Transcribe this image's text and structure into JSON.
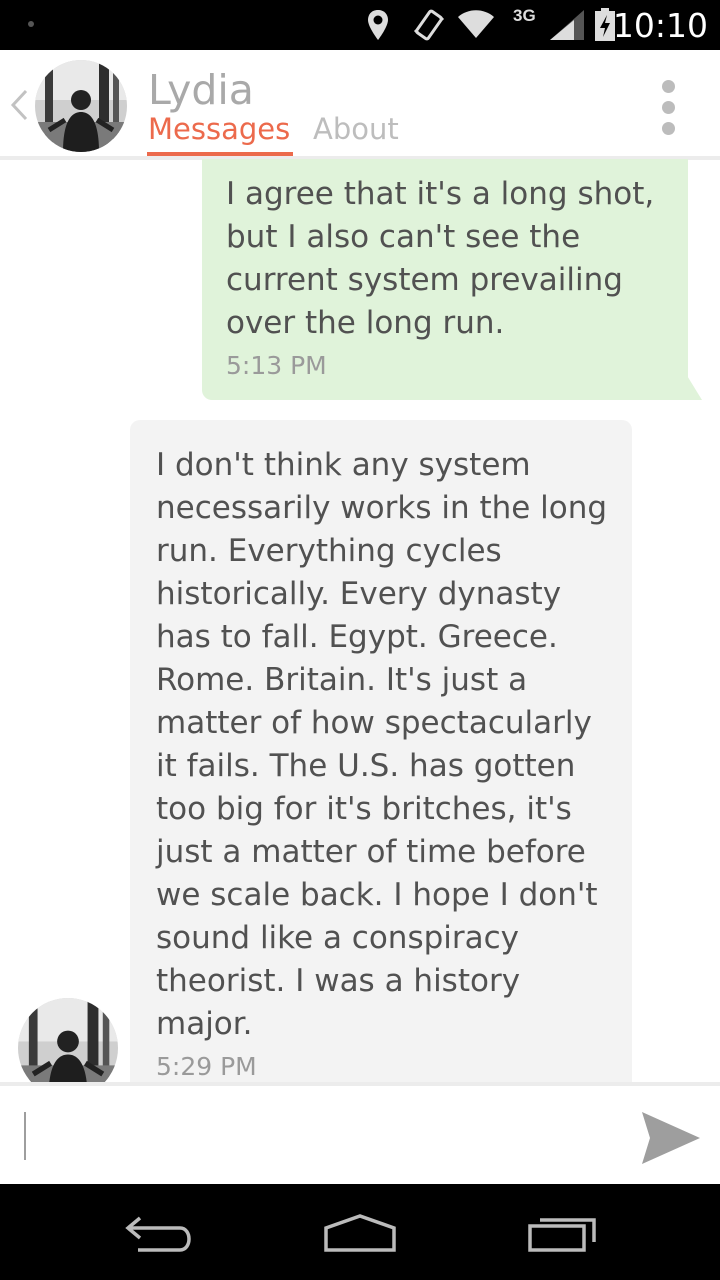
{
  "status_bar": {
    "network_label": "3G",
    "time": "10:10",
    "icons": [
      "location-pin-icon",
      "vibrate-icon",
      "wifi-icon",
      "cell-signal-icon",
      "battery-icon"
    ]
  },
  "header": {
    "contact_name": "Lydia",
    "tabs": [
      {
        "label": "Messages",
        "active": true
      },
      {
        "label": "About",
        "active": false
      }
    ],
    "accent_color": "#ec6a4c"
  },
  "messages": [
    {
      "direction": "sent",
      "text": "I agree that it's a long shot,\nbut I also can't see the\ncurrent system prevailing\nover the long run.",
      "time": "5:13 PM"
    },
    {
      "direction": "received",
      "text": "I don't think any system\nnecessarily works in the long\nrun. Everything cycles\nhistorically. Every dynasty\nhas to fall. Egypt. Greece.\nRome. Britain. It's just a\nmatter of how spectacularly\nit fails. The U.S. has gotten\ntoo big for it's britches, it's\njust a matter of time before\nwe scale back. I hope I don't\nsound like a conspiracy\ntheorist. I was a history\nmajor.",
      "time": "5:29 PM"
    }
  ],
  "composer": {
    "value": "",
    "placeholder": ""
  },
  "colors": {
    "sent_bubble": "#e0f3da",
    "received_bubble": "#f3f3f3"
  }
}
